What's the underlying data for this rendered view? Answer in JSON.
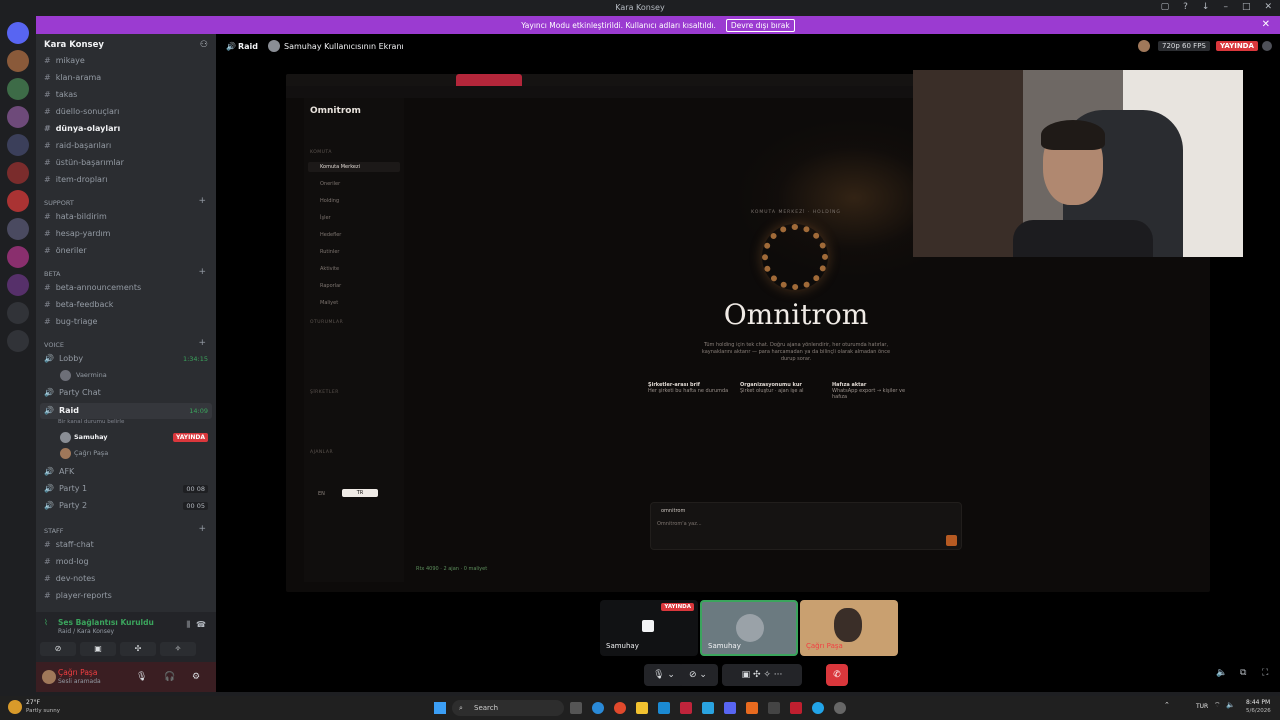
{
  "window": {
    "title": "Kara Konsey"
  },
  "banner": {
    "text": "Yayıncı Modu etkinleştirildi. Kullanıcı adları kısaltıldı.",
    "button": "Devre dışı bırak"
  },
  "server": {
    "name": "Kara Konsey"
  },
  "channels_top": [
    "mikaye",
    "klan-arama",
    "takas",
    "düello-sonuçları",
    "dünya-olayları",
    "raid-başarıları",
    "üstün-başarımlar",
    "item-dropları"
  ],
  "support": {
    "label": "SUPPORT",
    "items": [
      "hata-bildirim",
      "hesap-yardım",
      "öneriler"
    ]
  },
  "beta": {
    "label": "BETA",
    "items": [
      "beta-announcements",
      "beta-feedback",
      "bug-triage"
    ]
  },
  "voice": {
    "label": "VOICE",
    "lobby": {
      "name": "Lobby",
      "time": "1:34:15",
      "user": "Vaermina"
    },
    "party_chat": "Party Chat",
    "raid": {
      "name": "Raid",
      "time": "14:09",
      "status": "Bir kanal durumu belirle",
      "user1": "Samuhay",
      "live": "YAYINDA",
      "user2": "Çağrı Paşa"
    },
    "afk": "AFK",
    "party1": {
      "name": "Party 1",
      "count": "00 08"
    },
    "party2": {
      "name": "Party 2",
      "count": "00 05"
    }
  },
  "staff": {
    "label": "STAFF",
    "items": [
      "staff-chat",
      "mod-log",
      "dev-notes",
      "player-reports"
    ]
  },
  "voice_panel": {
    "status": "Ses Bağlantısı Kuruldu",
    "sub": "Raid / Kara Konsey",
    "user": "Çağrı Paşa",
    "user_status": "Sesli aramada"
  },
  "main_header": {
    "channel": "Raid",
    "title": "Samuhay Kullanıcısının Ekranı",
    "quality": "720p 60 FPS",
    "live": "YAYINDA"
  },
  "stream": {
    "brand": "Omnitrom",
    "nav_items": [
      "Komuta Merkezi",
      "Oneriler",
      "Holding",
      "İşler",
      "Hedefler",
      "Rutinler",
      "Aktivite",
      "Raporlar",
      "Maliyet"
    ],
    "nav_sections": [
      "KOMUTA",
      "OTURUMLAR",
      "ŞİRKETLER",
      "AJANLAR"
    ],
    "hero_title": "Omnitrom",
    "hero_label": "KOMUTA MERKEZİ · HOLDİNG",
    "hero_desc": "Tüm holding için tek chat. Doğru ajana yönlendirir, her oturumda hatırlar, kaynaklarını aktarır — para harcamadan ya da bilinçli olarak almadan önce durup sorar.",
    "cards": [
      {
        "title": "Şirketler-arası brif",
        "sub": "Her şirketi bu hafta ne durumda"
      },
      {
        "title": "Organizasyonumu kur",
        "sub": "Şirket oluştur · ajan işe al"
      },
      {
        "title": "Hafıza aktar",
        "sub": "WhatsApp export → kişiler ve hafıza"
      }
    ],
    "chat_label": "omnitrom",
    "chat_placeholder": "Omnitrom'a yaz...",
    "statusline": "Rtx 4090 · 2 ajan · 0 maliyet",
    "lang": [
      "EN",
      "TR"
    ]
  },
  "tiles": [
    {
      "name": "Samuhay",
      "live": "YAYINDA"
    },
    {
      "name": "Samuhay"
    },
    {
      "name": "Çağrı Paşa"
    }
  ],
  "taskbar": {
    "search": "Search",
    "temp": "27°F",
    "weather": "Partly sunny",
    "lang": "TUR",
    "time": "8:44 PM",
    "date": "5/6/2026"
  },
  "colors": {
    "accent": "#9b3bd1",
    "live": "#da373c",
    "voice_green": "#3ba55d",
    "bg": "#1e1f22"
  }
}
